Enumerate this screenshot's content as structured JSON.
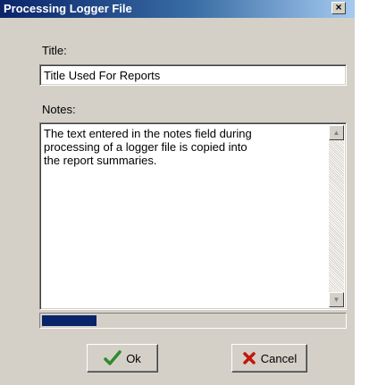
{
  "window": {
    "title": "Processing Logger File",
    "close_glyph": "×"
  },
  "fields": {
    "title_label": "Title:",
    "title_value": "Title Used For Reports",
    "notes_label": "Notes:",
    "notes_value": "The text entered in the notes field during\nprocessing of a logger file is copied into\nthe report summaries."
  },
  "progress": {
    "fraction": 0.18
  },
  "buttons": {
    "ok_label": "Ok",
    "cancel_label": "Cancel"
  },
  "icons": {
    "ok": "checkmark-icon",
    "cancel": "x-icon",
    "close": "close-icon",
    "scroll_up": "scroll-up-icon",
    "scroll_down": "scroll-down-icon"
  },
  "colors": {
    "titlebar": "#0a246a",
    "check": "#2e8b2e",
    "cross": "#c0180c",
    "progress": "#0a246a"
  }
}
